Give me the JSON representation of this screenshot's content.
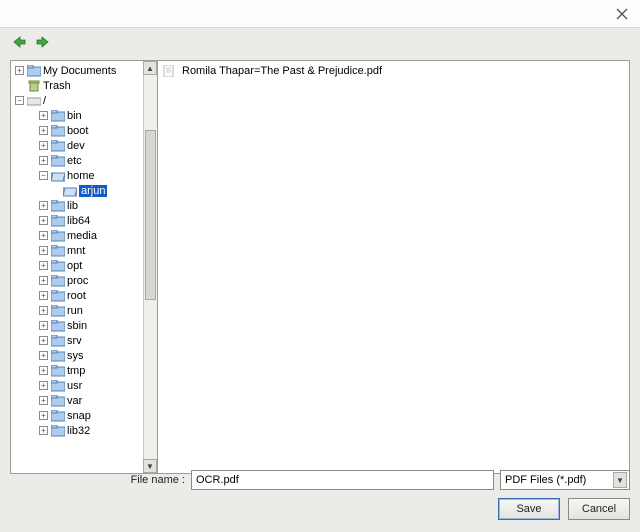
{
  "title": "",
  "toolbar": {
    "back": "back",
    "forward": "forward"
  },
  "tree": {
    "mydocs": "My Documents",
    "trash": "Trash",
    "root": "/",
    "dirs": {
      "bin": "bin",
      "boot": "boot",
      "dev": "dev",
      "etc": "etc",
      "home": "home",
      "arjun": "arjun",
      "lib": "lib",
      "lib64": "lib64",
      "media": "media",
      "mnt": "mnt",
      "opt": "opt",
      "proc": "proc",
      "root": "root",
      "run": "run",
      "sbin": "sbin",
      "srv": "srv",
      "sys": "sys",
      "tmp": "tmp",
      "usr": "usr",
      "var": "var",
      "snap": "snap",
      "lib32": "lib32"
    }
  },
  "filelist": {
    "items": [
      {
        "name": "Romila Thapar=The Past & Prejudice.pdf"
      }
    ]
  },
  "filename_label": "File name :",
  "filename_value": "OCR.pdf",
  "filetype_value": "PDF Files (*.pdf)",
  "buttons": {
    "save": "Save",
    "cancel": "Cancel"
  }
}
